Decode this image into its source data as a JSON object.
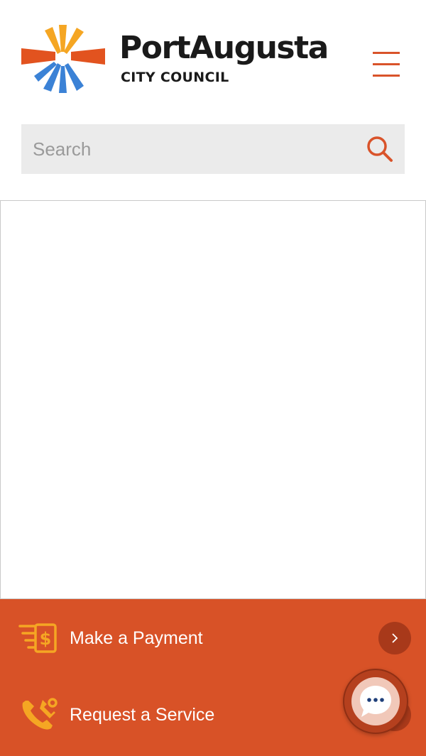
{
  "header": {
    "logo_name": "PortAugusta",
    "logo_sub": "CITY COUNCIL"
  },
  "search": {
    "placeholder": "Search"
  },
  "quick_links": [
    {
      "label": "Make a Payment",
      "icon": "payment-icon"
    },
    {
      "label": "Request a Service",
      "icon": "service-icon"
    }
  ],
  "colors": {
    "accent": "#d85227",
    "accent_dark": "#a8391a",
    "icon_yellow": "#f5a623",
    "logo_blue": "#3b82d6",
    "text_dark": "#1a1a1a"
  }
}
